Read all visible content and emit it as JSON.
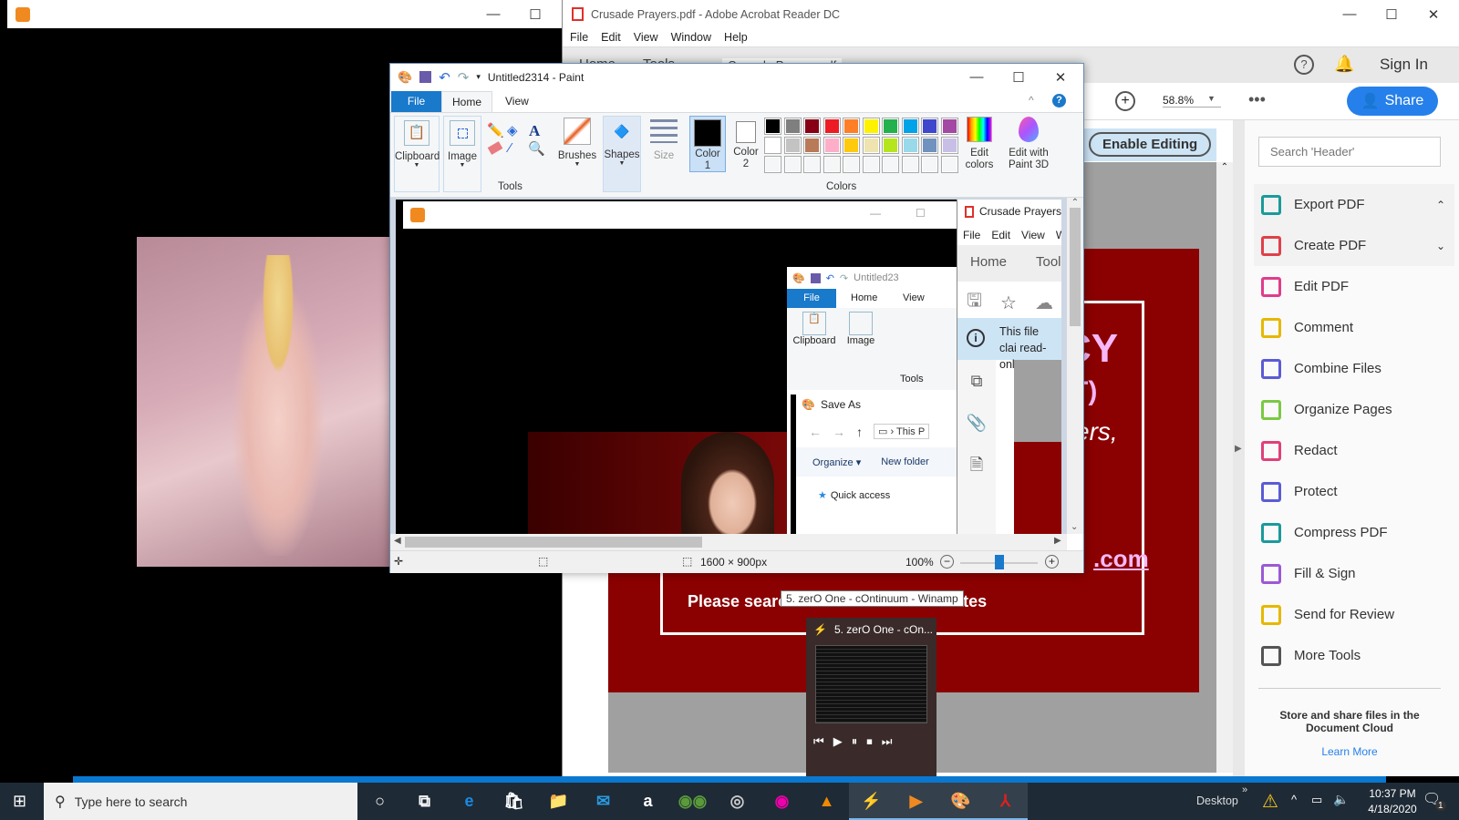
{
  "media_window": {
    "title": ""
  },
  "acrobat": {
    "title": "Crusade Prayers.pdf - Adobe Acrobat Reader DC",
    "menu": [
      "File",
      "Edit",
      "View",
      "Window",
      "Help"
    ],
    "tabs": [
      "Home",
      "Tools",
      "Crusade Prayers.pdf"
    ],
    "sign_in": "Sign In",
    "zoom": "58.8%",
    "share": "Share",
    "enable_editing": "Enable Editing",
    "search_placeholder": "Search 'Header'",
    "tools": [
      {
        "label": "Export PDF",
        "icon": "export-pdf-icon",
        "color": "#1a9a9a"
      },
      {
        "label": "Create PDF",
        "icon": "create-pdf-icon",
        "color": "#e0404a"
      },
      {
        "label": "Edit PDF",
        "icon": "edit-pdf-icon",
        "color": "#e03c8c"
      },
      {
        "label": "Comment",
        "icon": "comment-icon",
        "color": "#e6b800"
      },
      {
        "label": "Combine Files",
        "icon": "combine-files-icon",
        "color": "#5b5bd6"
      },
      {
        "label": "Organize Pages",
        "icon": "organize-pages-icon",
        "color": "#7ac943"
      },
      {
        "label": "Redact",
        "icon": "redact-icon",
        "color": "#e0407a"
      },
      {
        "label": "Protect",
        "icon": "protect-icon",
        "color": "#5b5bd6"
      },
      {
        "label": "Compress PDF",
        "icon": "compress-pdf-icon",
        "color": "#1a9a9a"
      },
      {
        "label": "Fill & Sign",
        "icon": "fill-sign-icon",
        "color": "#9b59d6"
      },
      {
        "label": "Send for Review",
        "icon": "send-review-icon",
        "color": "#e6b800"
      },
      {
        "label": "More Tools",
        "icon": "more-tools-icon",
        "color": "#555555"
      }
    ],
    "cloud_text": "Store and share files in the Document Cloud",
    "learn_more": "Learn More",
    "doc": {
      "line1": "CY",
      "line2": "T)",
      "line3": "ers,",
      "link": ".com",
      "footer": "Please search for other MDM websites",
      "page_color": "#8b0000"
    }
  },
  "paint": {
    "title": "Untitled2314 - Paint",
    "tabs": [
      "File",
      "Home",
      "View"
    ],
    "groups": {
      "clipboard": "Clipboard",
      "image": "Image",
      "tools": "Tools",
      "brushes": "Brushes",
      "shapes": "Shapes",
      "size": "Size",
      "color1": "Color 1",
      "color2": "Color 2",
      "colors": "Colors",
      "edit_colors": "Edit colors",
      "paint3d": "Edit with Paint 3D"
    },
    "palette_row1": [
      "#000000",
      "#7f7f7f",
      "#880015",
      "#ed1c24",
      "#ff7f27",
      "#fff200",
      "#22b14c",
      "#00a2e8",
      "#3f48cc",
      "#a349a4"
    ],
    "palette_row2": [
      "#ffffff",
      "#c3c3c3",
      "#b97a57",
      "#ffaec9",
      "#ffc90e",
      "#efe4b0",
      "#b5e61d",
      "#99d9ea",
      "#7092be",
      "#c8bfe7"
    ],
    "status": {
      "dimensions": "1600 × 900px",
      "zoom": "100%",
      "zoom_level": 0.5
    }
  },
  "inner": {
    "acrobat_title": "Crusade Prayers.p",
    "acrobat_menu": [
      "File",
      "Edit",
      "View",
      "W"
    ],
    "acrobat_tabs": [
      "Home",
      "Tools"
    ],
    "notice": "This file clai read-only t",
    "paint_title": "Untitled23",
    "paint_tabs": [
      "File",
      "Home",
      "View"
    ],
    "clipboard": "Clipboard",
    "image": "Image",
    "tools": "Tools",
    "saveas_title": "Save As",
    "path": "This P",
    "organize": "Organize ▾",
    "new_folder": "New folder",
    "quick_access": "Quick access"
  },
  "tooltip": "5. zerO One - cOntinuum - Winamp",
  "thumbnail": {
    "title": "5. zerO One - cOn..."
  },
  "taskbar": {
    "search_placeholder": "Type here to search",
    "desktop": "Desktop",
    "time": "10:37 PM",
    "date": "4/18/2020",
    "notifications": "1",
    "apps": [
      "cortana-icon",
      "task-view-icon",
      "edge-icon",
      "store-icon",
      "file-explorer-icon",
      "mail-icon",
      "amazon-icon",
      "tripadvisor-icon",
      "webcam-icon",
      "color-app-icon",
      "vlc-icon",
      "winamp-icon",
      "media-player-icon",
      "paint-icon",
      "acrobat-icon"
    ]
  }
}
